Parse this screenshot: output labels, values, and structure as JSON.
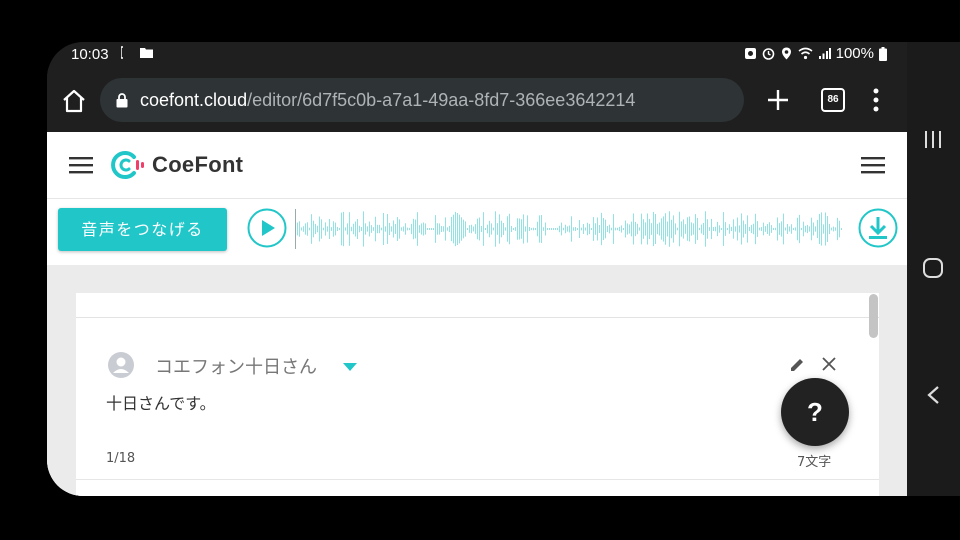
{
  "status_bar": {
    "time": "10:03",
    "battery": "100%"
  },
  "browser": {
    "url_host": "coefont.cloud",
    "url_path": "/editor/6d7f5c0b-a7a1-49aa-8fd7-366ee3642214",
    "tab_count": "86"
  },
  "site": {
    "logo_text": "CoeFont",
    "brand_color": "#21c6c8",
    "accent_pink": "#ef3f6b"
  },
  "audio": {
    "connect_label": "音声をつなげる"
  },
  "card": {
    "speaker_name": "コエフォン十日さん",
    "sentence": "十日さんです。",
    "counter": "1/18",
    "char_count": "7文字"
  },
  "help": {
    "label": "?"
  },
  "icons": [
    "home-icon",
    "lock-icon",
    "plus-icon",
    "tabs-icon",
    "more-vert-icon",
    "hamburger-icon",
    "coefont-logo-icon",
    "play-icon",
    "waveform",
    "download-icon",
    "avatar-icon",
    "caret-down-icon",
    "edit-icon",
    "close-icon",
    "recents-icon",
    "home-nav-icon",
    "back-icon"
  ]
}
